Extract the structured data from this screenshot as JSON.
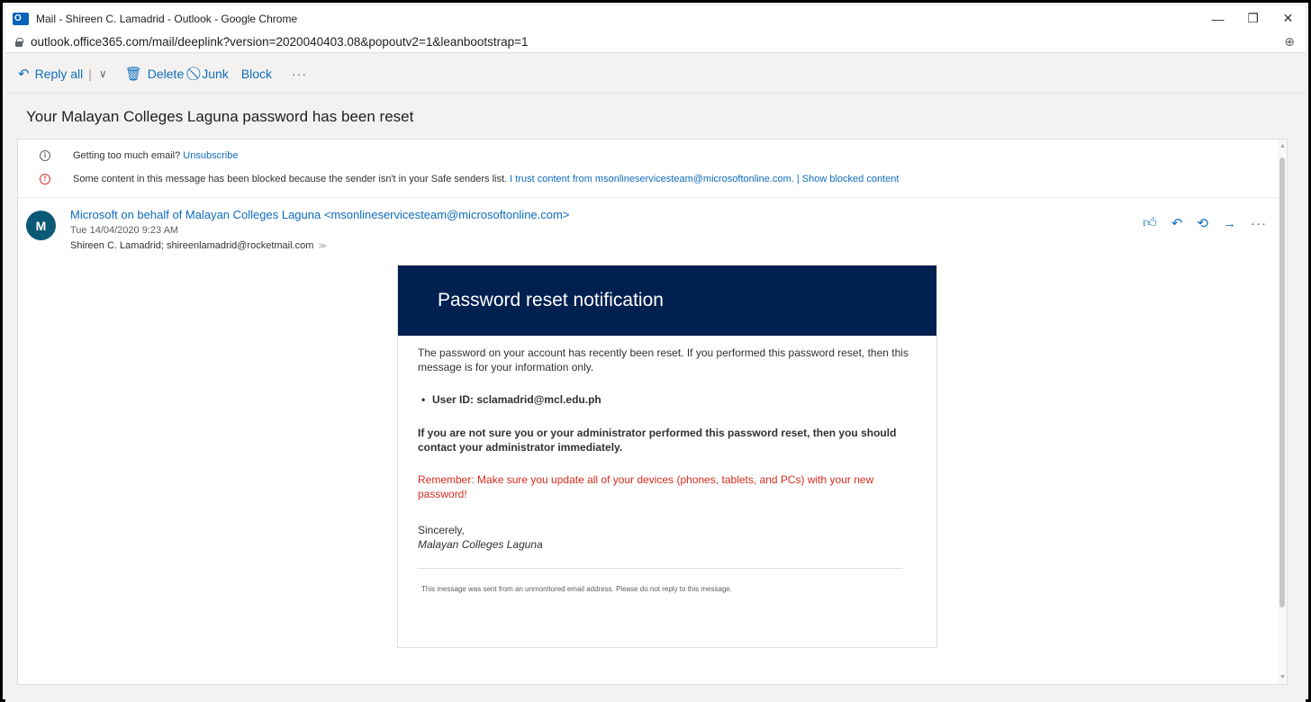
{
  "window": {
    "title": "Mail - Shireen C. Lamadrid - Outlook - Google Chrome",
    "minimize": "—",
    "restore": "❐",
    "close": "✕"
  },
  "address": {
    "url": "outlook.office365.com/mail/deeplink?version=2020040403.08&popoutv2=1&leanbootstrap=1",
    "zoom_icon": "⊕"
  },
  "toolbar": {
    "reply_all": "Reply all",
    "delete": "Delete",
    "junk": "Junk",
    "block": "Block",
    "more": "···"
  },
  "message": {
    "subject": "Your Malayan Colleges Laguna password has been reset",
    "info_unsubscribe_text": "Getting too much email?",
    "info_unsubscribe_link": "Unsubscribe",
    "info_blocked_text": "Some content in this message has been blocked because the sender isn't in your Safe senders list.",
    "info_trust_link": "I trust content from msonlineservicesteam@microsoftonline.com.",
    "info_sep": "|",
    "info_show_link": "Show blocked content",
    "avatar_initial": "M",
    "sender": "Microsoft on behalf of Malayan Colleges Laguna <msonlineservicesteam@microsoftonline.com>",
    "date": "Tue 14/04/2020 9:23 AM",
    "recipients": "Shireen C. Lamadrid; shireenlamadrid@rocketmail.com"
  },
  "email": {
    "header": "Password reset notification",
    "p1": "The password on your account has recently been reset. If you performed this password reset, then this message is for your information only.",
    "user_id": "User ID: sclamadrid@mcl.edu.ph",
    "warning": "If you are not sure you or your administrator performed this password reset, then you should contact your administrator immediately.",
    "remember": "Remember: Make sure you update all of your devices (phones, tablets, and PCs) with your new password!",
    "sincerely": "Sincerely,",
    "org": "Malayan Colleges Laguna",
    "footer": "This message was sent from an unmonitored email address. Please do not reply to this message."
  },
  "colors": {
    "accent": "#106ebe",
    "header_bg": "#002050",
    "warning_red": "#d52b1e",
    "avatar_bg": "#0b5a75"
  }
}
